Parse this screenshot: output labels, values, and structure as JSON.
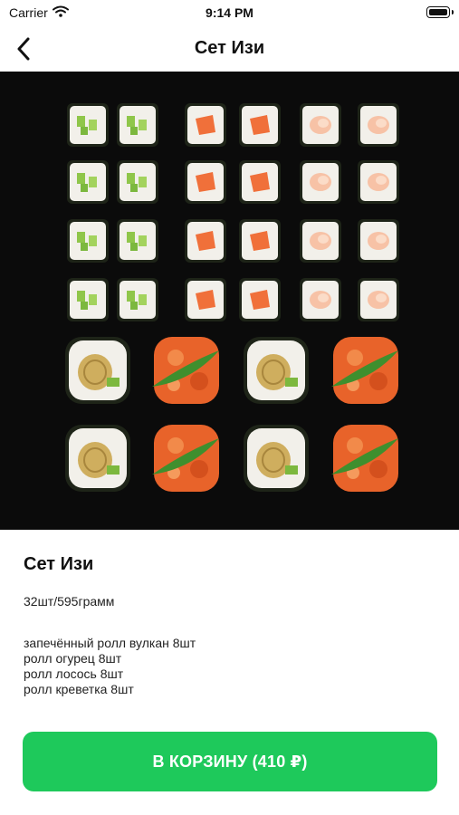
{
  "status_bar": {
    "carrier": "Carrier",
    "time": "9:14 PM"
  },
  "nav": {
    "title": "Сет Изи"
  },
  "product": {
    "title": "Сет Изи",
    "weight": "32шт/595грамм",
    "composition": [
      "запечённый ролл вулкан 8шт",
      "ролл огурец 8шт",
      "ролл лосось 8шт",
      "ролл креветка 8шт"
    ]
  },
  "cart_button": {
    "label": "В КОРЗИНУ (410 ₽)"
  },
  "colors": {
    "accent": "#1ec95b",
    "hero_background": "#0b0b0b"
  }
}
